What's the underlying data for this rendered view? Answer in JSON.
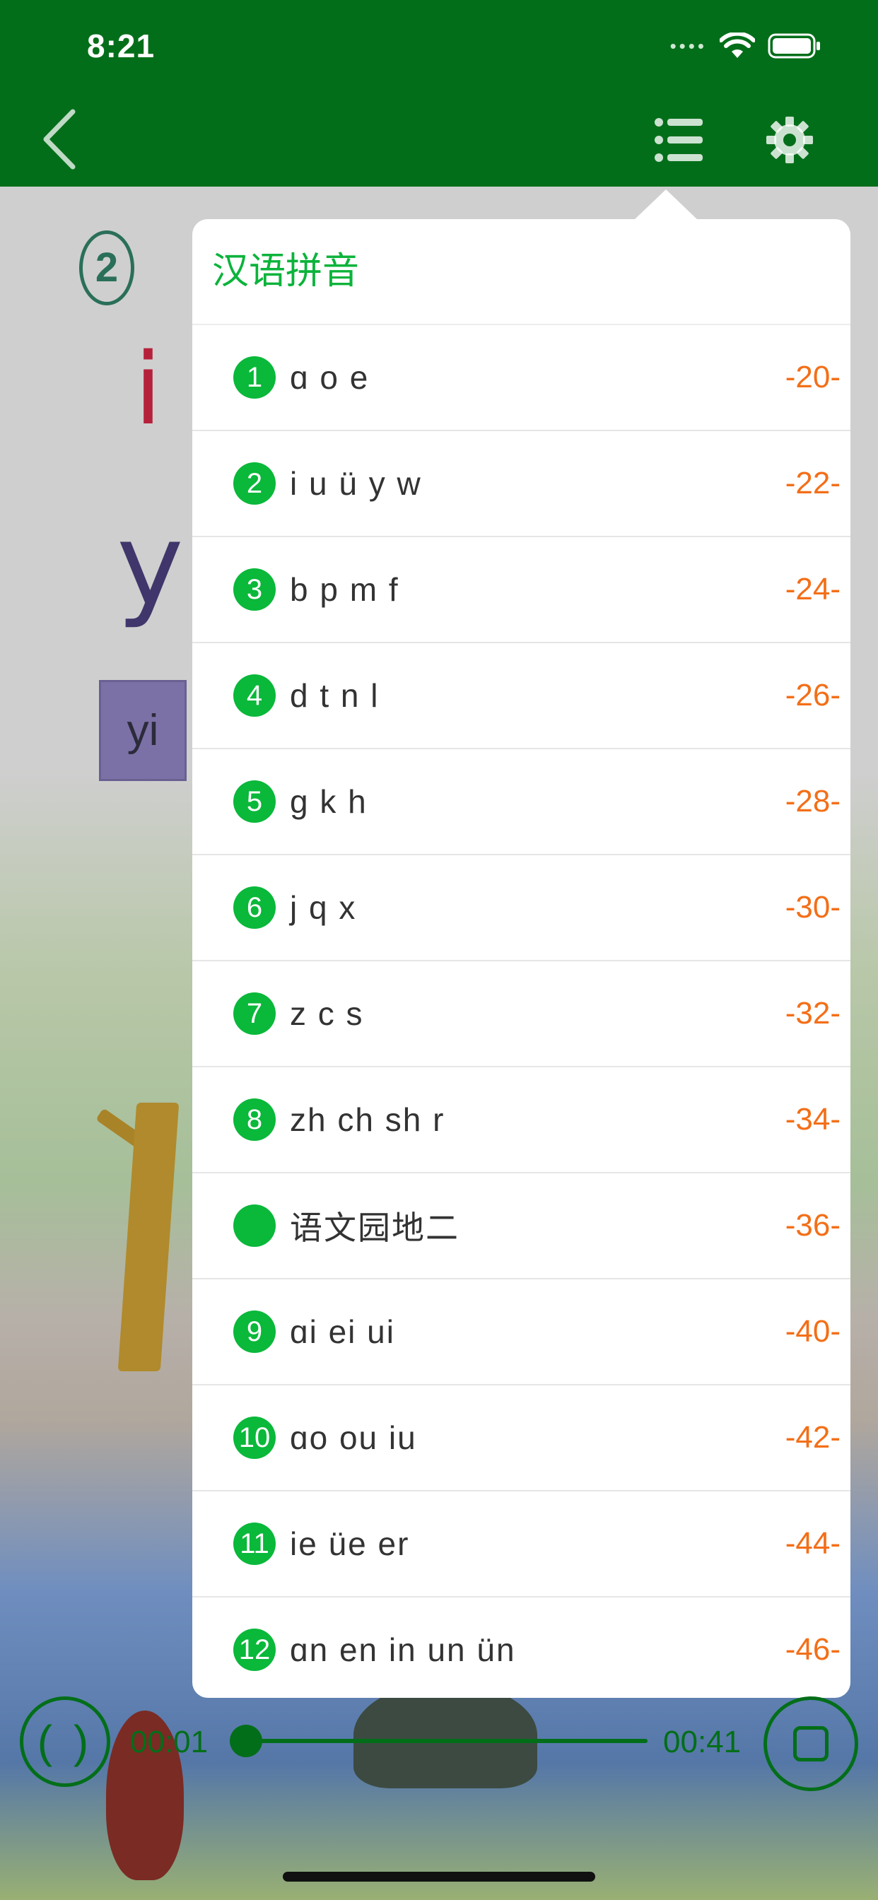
{
  "status": {
    "time": "8:21"
  },
  "player": {
    "current": "00:01",
    "total": "00:41",
    "progress": 0.03,
    "play_symbol": "( )"
  },
  "background": {
    "circle_num": "2",
    "letter_i": "i",
    "letter_y": "y",
    "yi": "yi"
  },
  "popover": {
    "title": "汉语拼音",
    "items": [
      {
        "num": "1",
        "label": "ɑ o e",
        "page": "-20-"
      },
      {
        "num": "2",
        "label": "i u ü y w",
        "page": "-22-"
      },
      {
        "num": "3",
        "label": "b p m f",
        "page": "-24-"
      },
      {
        "num": "4",
        "label": "d t n l",
        "page": "-26-"
      },
      {
        "num": "5",
        "label": "g k h",
        "page": "-28-"
      },
      {
        "num": "6",
        "label": "j q x",
        "page": "-30-"
      },
      {
        "num": "7",
        "label": "z c s",
        "page": "-32-"
      },
      {
        "num": "8",
        "label": "zh ch sh r",
        "page": "-34-"
      },
      {
        "num": "",
        "label": "语文园地二",
        "page": "-36-"
      },
      {
        "num": "9",
        "label": "ɑi ei ui",
        "page": "-40-"
      },
      {
        "num": "10",
        "label": "ɑo ou iu",
        "page": "-42-"
      },
      {
        "num": "11",
        "label": "ie üe er",
        "page": "-44-"
      },
      {
        "num": "12",
        "label": "ɑn en in un ün",
        "page": "-46-"
      }
    ]
  },
  "colors": {
    "nav_green": "#036e19",
    "accent_green": "#0ab83a",
    "page_orange": "#f36f18"
  }
}
